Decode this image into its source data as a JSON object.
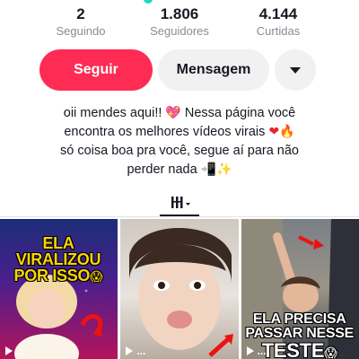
{
  "stats": [
    {
      "count": "2",
      "label": "Seguindo"
    },
    {
      "count": "1.806",
      "label": "Seguidores"
    },
    {
      "count": "4.144",
      "label": "Curtidas"
    }
  ],
  "actions": {
    "follow_label": "Seguir",
    "message_label": "Mensagem",
    "more_icon": "chevron-down-icon"
  },
  "bio": {
    "line1": "oii mendes aqui!!",
    "line2": "Nessa página você",
    "line3": "encontra os melhores vídeos virais",
    "line4": "só coisa boa pra você, segue aí para não",
    "line5": "perder nada"
  },
  "tabs": {
    "videos_icon": "grid-videos-icon"
  },
  "videos": [
    {
      "caption_line1": "ELA VIRALIZOU",
      "caption_line2": "POR ISSO",
      "views": "..."
    },
    {
      "views": "..."
    },
    {
      "caption_line1": "ELA PRECISA",
      "caption_line2": "PASSAR NESSE",
      "caption_line3": "TESTE",
      "views": "..."
    }
  ],
  "colors": {
    "accent": "#fe2c55",
    "secondary_button": "#f1f1f2",
    "muted_text": "#8a8b91"
  }
}
